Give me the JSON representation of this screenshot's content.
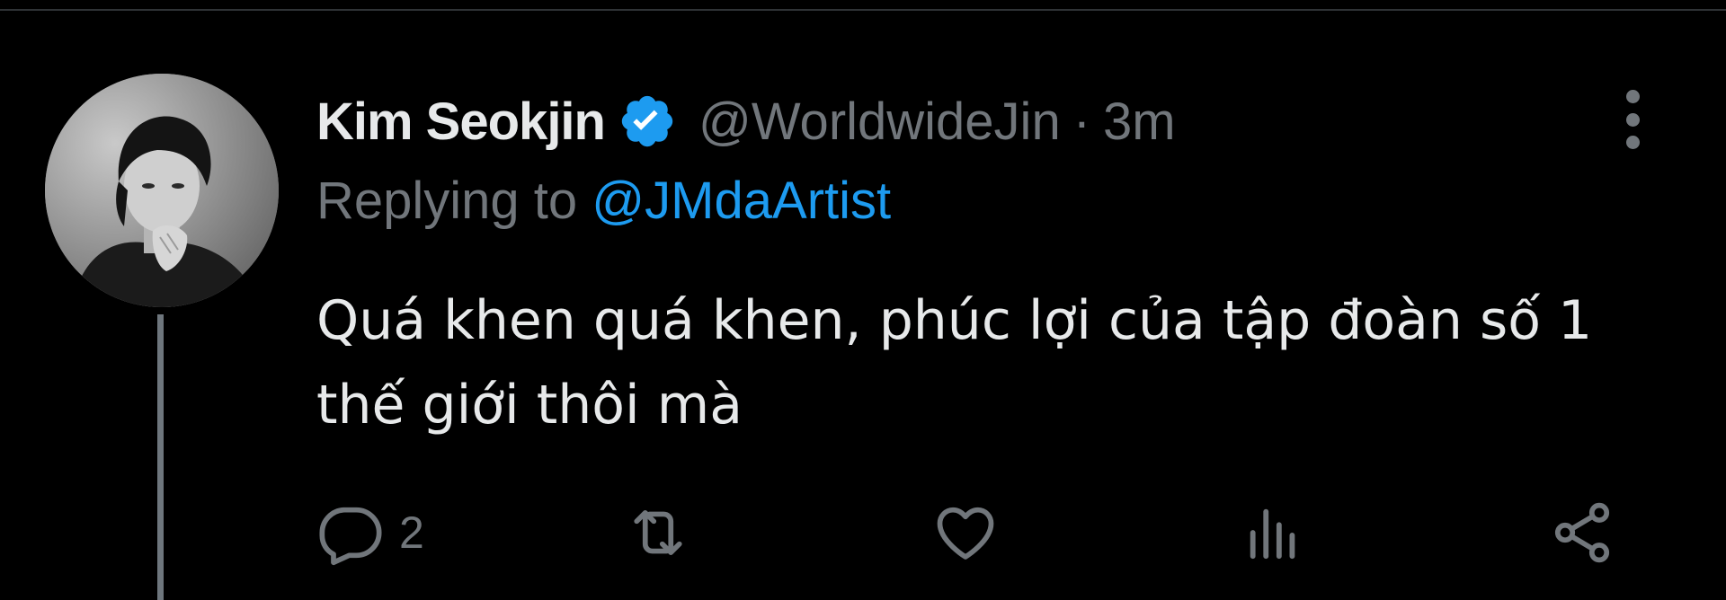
{
  "tweet": {
    "display_name": "Kim Seokjin",
    "verified": true,
    "handle": "@WorldwideJin",
    "separator": "·",
    "time": "3m",
    "replying_prefix": "Replying to",
    "replying_to": "@JMdaArtist",
    "text": "Quá khen quá khen, phúc lợi của tập đoàn số 1 thế giới thôi mà",
    "reply_count": "2"
  },
  "colors": {
    "background": "#000000",
    "primary_text": "#e7e9ea",
    "secondary_text": "#71767b",
    "accent": "#1d9bf0"
  },
  "icons": {
    "avatar": "profile-photo",
    "verified": "verified-badge-icon",
    "more": "more-vertical-icon",
    "reply": "reply-icon",
    "retweet": "retweet-icon",
    "like": "heart-icon",
    "views": "views-chart-icon",
    "share": "share-icon"
  }
}
